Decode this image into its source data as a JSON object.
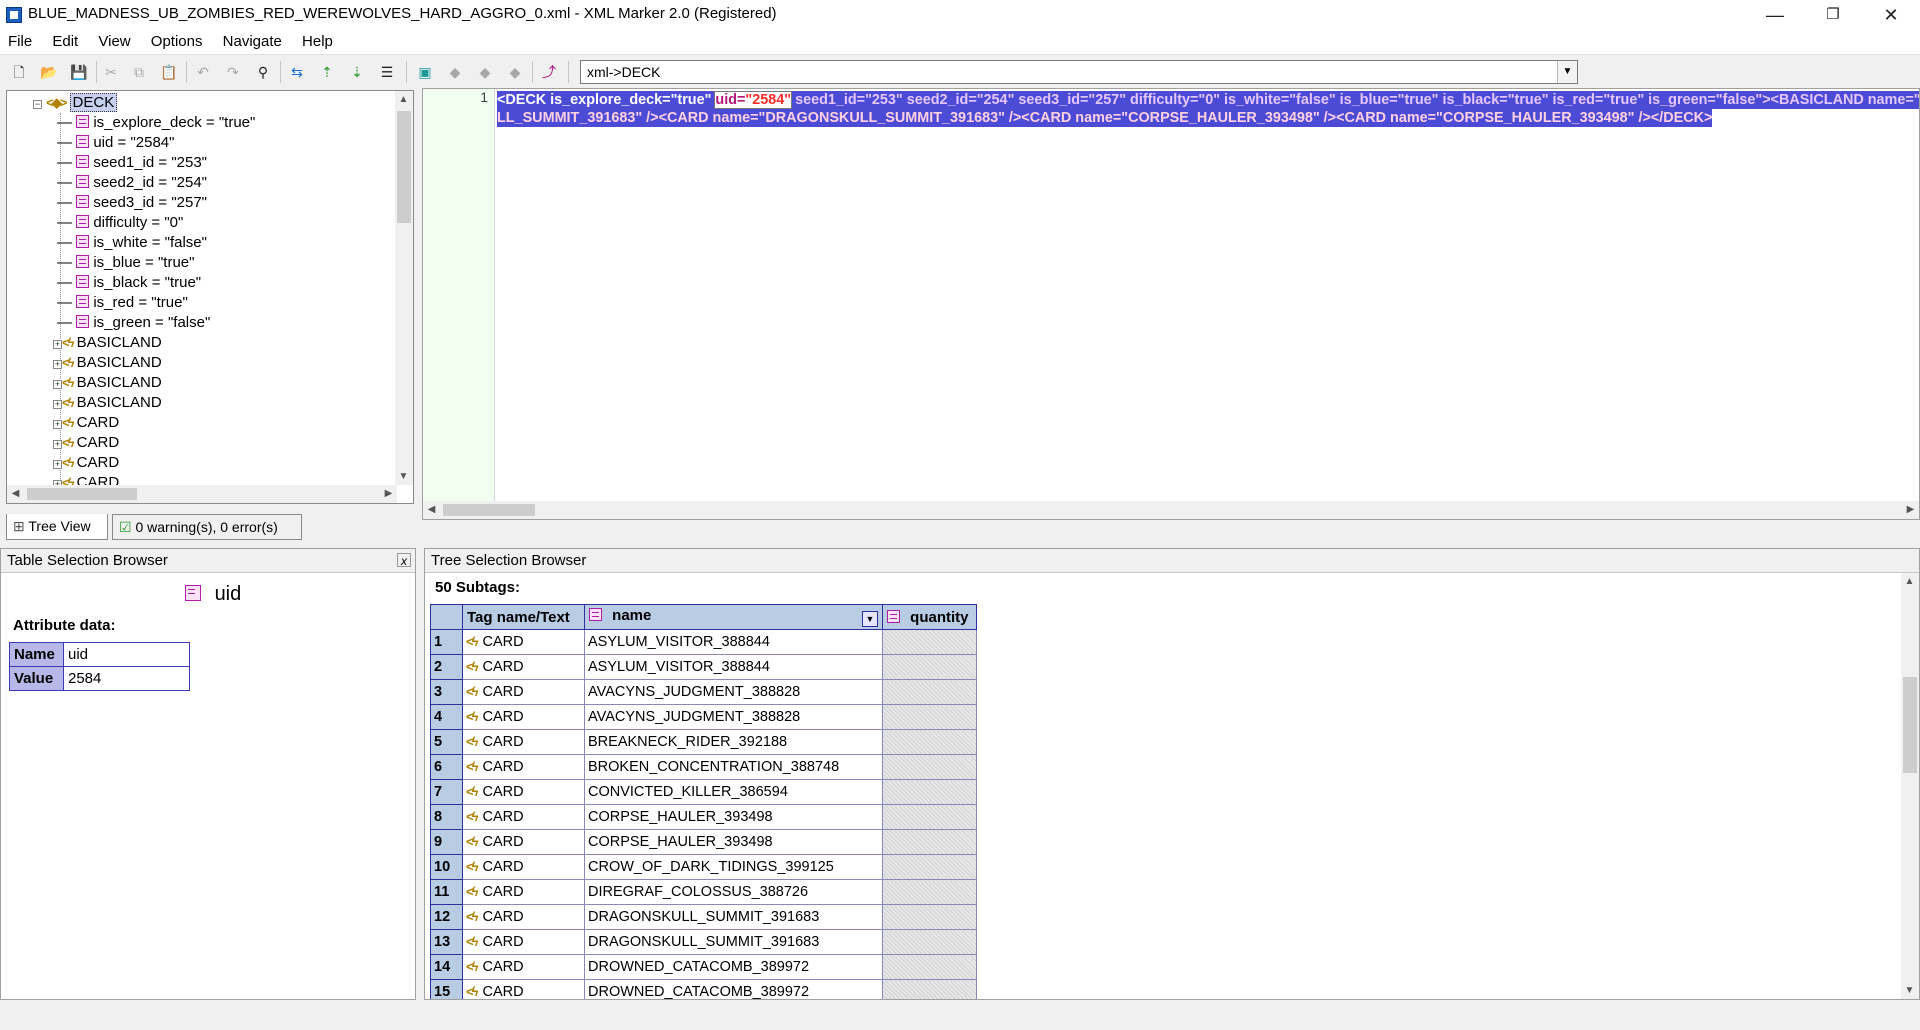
{
  "window": {
    "title": "BLUE_MADNESS_UB_ZOMBIES_RED_WEREWOLVES_HARD_AGGRO_0.xml - XML Marker 2.0 (Registered)",
    "minimize": "—",
    "maximize": "❐",
    "close": "✕"
  },
  "menu": [
    "File",
    "Edit",
    "View",
    "Options",
    "Navigate",
    "Help"
  ],
  "toolbar": {
    "xpath_value": "xml->DECK"
  },
  "tree": {
    "root": "DECK",
    "attributes": [
      "is_explore_deck = \"true\"",
      "uid = \"2584\"",
      "seed1_id = \"253\"",
      "seed2_id = \"254\"",
      "seed3_id = \"257\"",
      "difficulty = \"0\"",
      "is_white = \"false\"",
      "is_blue = \"true\"",
      "is_black = \"true\"",
      "is_red = \"true\"",
      "is_green = \"false\""
    ],
    "children": [
      "BASICLAND",
      "BASICLAND",
      "BASICLAND",
      "BASICLAND",
      "CARD",
      "CARD",
      "CARD",
      "CARD"
    ]
  },
  "tabs": {
    "tree_view": "Tree View",
    "warnings": "0 warning(s), 0 error(s)"
  },
  "editor": {
    "line_number": "1",
    "line1": {
      "p1": "<DECK is_explore_deck=\"true\" ",
      "uid_attr": "uid=",
      "uid_val": "\"2584\"",
      "p2": " seed1_id=\"253\" seed2_id=\"254\" seed3_id=\"257\" difficulty=\"0\" is_white=\"false\" is_blue=\"true\" is_black=\"true\" is_red=\"true\" is_green=\"false\"><BASICLAND name=\"Isla"
    },
    "line2": "LL_SUMMIT_391683\" /><CARD name=\"DRAGONSKULL_SUMMIT_391683\" /><CARD name=\"CORPSE_HAULER_393498\" /><CARD name=\"CORPSE_HAULER_393498\" /></DECK>"
  },
  "table_browser": {
    "title": "Table Selection Browser",
    "close": "x",
    "selected": "uid",
    "attr_heading": "Attribute data:",
    "name_label": "Name",
    "name_value": "uid",
    "value_label": "Value",
    "value_value": "2584"
  },
  "tree_browser": {
    "title": "Tree Selection Browser",
    "subtags": "50 Subtags:",
    "col_tag": "Tag name/Text",
    "col_name": "name",
    "col_qty": "quantity",
    "rows": [
      {
        "n": "1",
        "tag": "CARD",
        "name": "ASYLUM_VISITOR_388844"
      },
      {
        "n": "2",
        "tag": "CARD",
        "name": "ASYLUM_VISITOR_388844"
      },
      {
        "n": "3",
        "tag": "CARD",
        "name": "AVACYNS_JUDGMENT_388828"
      },
      {
        "n": "4",
        "tag": "CARD",
        "name": "AVACYNS_JUDGMENT_388828"
      },
      {
        "n": "5",
        "tag": "CARD",
        "name": "BREAKNECK_RIDER_392188"
      },
      {
        "n": "6",
        "tag": "CARD",
        "name": "BROKEN_CONCENTRATION_388748"
      },
      {
        "n": "7",
        "tag": "CARD",
        "name": "CONVICTED_KILLER_386594"
      },
      {
        "n": "8",
        "tag": "CARD",
        "name": "CORPSE_HAULER_393498"
      },
      {
        "n": "9",
        "tag": "CARD",
        "name": "CORPSE_HAULER_393498"
      },
      {
        "n": "10",
        "tag": "CARD",
        "name": "CROW_OF_DARK_TIDINGS_399125"
      },
      {
        "n": "11",
        "tag": "CARD",
        "name": "DIREGRAF_COLOSSUS_388726"
      },
      {
        "n": "12",
        "tag": "CARD",
        "name": "DRAGONSKULL_SUMMIT_391683"
      },
      {
        "n": "13",
        "tag": "CARD",
        "name": "DRAGONSKULL_SUMMIT_391683"
      },
      {
        "n": "14",
        "tag": "CARD",
        "name": "DROWNED_CATACOMB_389972"
      },
      {
        "n": "15",
        "tag": "CARD",
        "name": "DROWNED_CATACOMB_389972"
      }
    ]
  }
}
